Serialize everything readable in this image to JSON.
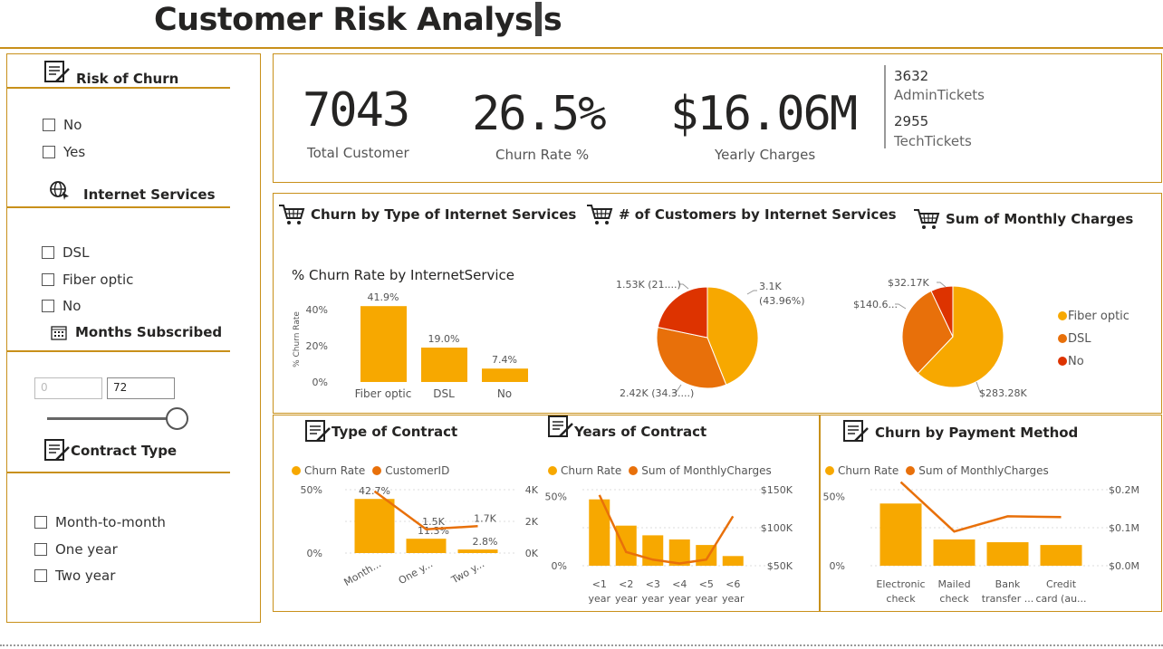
{
  "header": {
    "title": "Customer Risk Analysis"
  },
  "slicers": {
    "risk": {
      "title": "Risk of Churn",
      "options": [
        "No",
        "Yes"
      ]
    },
    "internet": {
      "title": "Internet Services",
      "options": [
        "DSL",
        "Fiber optic",
        "No"
      ]
    },
    "months": {
      "title": "Months Subscribed",
      "min": "0",
      "max": "72"
    },
    "contract": {
      "title": "Contract Type",
      "options": [
        "Month-to-month",
        "One year",
        "Two year"
      ]
    }
  },
  "kpis": {
    "total_customer": {
      "value": "7043",
      "label": "Total Customer"
    },
    "churn_rate": {
      "value": "26.5%",
      "label": "Churn Rate %"
    },
    "yearly_charges": {
      "value": "$16.06M",
      "label": "Yearly Charges"
    },
    "admin_tickets": {
      "value": "3632",
      "label": "AdminTickets"
    },
    "tech_tickets": {
      "value": "2955",
      "label": "TechTickets"
    }
  },
  "visuals": {
    "churn_internet": {
      "title": "Churn by Type of Internet Services",
      "subtitle": "% Churn Rate by InternetService",
      "ylabel": "% Churn Rate"
    },
    "customers_internet": {
      "title": "# of Customers by Internet Services"
    },
    "monthly_charges": {
      "title": "Sum of Monthly Charges"
    },
    "type_contract": {
      "title": "Type of Contract",
      "legend": [
        "Churn Rate",
        "CustomerID"
      ]
    },
    "years_contract": {
      "title": "Years of Contract",
      "legend": [
        "Churn Rate",
        "Sum of MonthlyCharges"
      ]
    },
    "payment": {
      "title": "Churn by Payment Method",
      "legend": [
        "Churn Rate",
        "Sum of MonthlyCharges"
      ]
    }
  },
  "colors": {
    "accent": "#c8901a",
    "series1": "#f7a800",
    "series2": "#e8700a",
    "series3": "#dd3300"
  },
  "chart_data": [
    {
      "type": "bar",
      "title": "% Churn Rate by InternetService",
      "categories": [
        "Fiber optic",
        "DSL",
        "No"
      ],
      "values": [
        41.9,
        19.0,
        7.4
      ],
      "data_labels": [
        "41.9%",
        "19.0%",
        "7.4%"
      ],
      "ylabel": "% Churn Rate",
      "yticks": [
        "0%",
        "20%",
        "40%"
      ],
      "ylim": [
        0,
        45
      ]
    },
    {
      "type": "pie",
      "slices": [
        {
          "name": "Fiber optic",
          "value": 3.1,
          "label": "3.1K",
          "pct": "(43.96%)"
        },
        {
          "name": "DSL",
          "value": 2.42,
          "label": "2.42K (34.3....)"
        },
        {
          "name": "No",
          "value": 1.53,
          "label": "1.53K (21....)"
        }
      ]
    },
    {
      "type": "pie",
      "slices": [
        {
          "name": "Fiber optic",
          "value": 283.28,
          "label": "$283.28K"
        },
        {
          "name": "DSL",
          "value": 140.6,
          "label": "$140.6..."
        },
        {
          "name": "No",
          "value": 32.17,
          "label": "$32.17K"
        }
      ],
      "legend": [
        "Fiber optic",
        "DSL",
        "No"
      ]
    },
    {
      "type": "bar",
      "categories": [
        "Month...",
        "One y...",
        "Two y..."
      ],
      "series": [
        {
          "name": "Churn Rate",
          "values": [
            42.7,
            11.3,
            2.8
          ],
          "labels": [
            "42.7%",
            "11.3%",
            "2.8%"
          ]
        },
        {
          "name": "CustomerID",
          "values": [
            3.9,
            1.5,
            1.7
          ],
          "labels": [
            "",
            "1.5K",
            "1.7K"
          ]
        }
      ],
      "yticks_left": [
        "0%",
        "50%"
      ],
      "yticks_right": [
        "0K",
        "2K",
        "4K"
      ]
    },
    {
      "type": "bar",
      "categories": [
        "<1 year",
        "<2 year",
        "<3 year",
        "<4 year",
        "<5 year",
        "<6 year"
      ],
      "cat_lines": [
        [
          "<1",
          "year"
        ],
        [
          "<2",
          "year"
        ],
        [
          "<3",
          "year"
        ],
        [
          "<4",
          "year"
        ],
        [
          "<5",
          "year"
        ],
        [
          "<6",
          "year"
        ]
      ],
      "series": [
        {
          "name": "Churn Rate",
          "values": [
            48,
            29,
            22,
            19,
            15,
            7
          ]
        },
        {
          "name": "Sum of MonthlyCharges",
          "values": [
            143,
            68,
            58,
            53,
            58,
            115
          ]
        }
      ],
      "yticks_left": [
        "0%",
        "50%"
      ],
      "yticks_right": [
        "$50K",
        "$100K",
        "$150K"
      ]
    },
    {
      "type": "bar",
      "categories": [
        "Electronic check",
        "Mailed check",
        "Bank transfer ...",
        "Credit card (au..."
      ],
      "cat_lines": [
        [
          "Electronic",
          "check"
        ],
        [
          "Mailed",
          "check"
        ],
        [
          "Bank",
          "transfer ..."
        ],
        [
          "Credit",
          "card (au..."
        ]
      ],
      "series": [
        {
          "name": "Churn Rate",
          "values": [
            45,
            19,
            17,
            15
          ]
        },
        {
          "name": "Sum of MonthlyCharges",
          "values": [
            0.22,
            0.09,
            0.13,
            0.128
          ]
        }
      ],
      "yticks_left": [
        "0%",
        "50%"
      ],
      "yticks_right": [
        "$0.0M",
        "$0.1M",
        "$0.2M"
      ]
    }
  ]
}
